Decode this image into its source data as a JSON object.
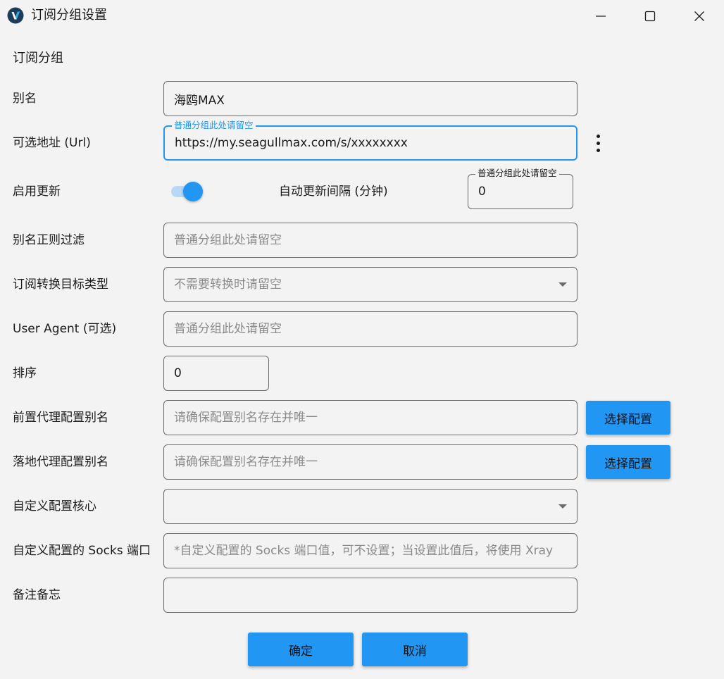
{
  "window": {
    "title": "订阅分组设置"
  },
  "section_title": "订阅分组",
  "form": {
    "alias": {
      "label": "别名",
      "value": "海鸥MAX"
    },
    "url": {
      "label": "可选地址 (Url)",
      "float_label": "普通分组此处请留空",
      "value": "https://my.seagullmax.com/s/xxxxxxxx"
    },
    "enable_update": {
      "label": "启用更新",
      "enabled": true
    },
    "auto_update_interval": {
      "label": "自动更新间隔 (分钟)",
      "float_label": "普通分组此处请留空",
      "value": "0"
    },
    "alias_regex": {
      "label": "别名正则过滤",
      "placeholder": "普通分组此处请留空"
    },
    "convert_target": {
      "label": "订阅转换目标类型",
      "placeholder": "不需要转换时请留空"
    },
    "user_agent": {
      "label": "User Agent (可选)",
      "placeholder": "普通分组此处请留空"
    },
    "sort": {
      "label": "排序",
      "value": "0"
    },
    "prev_proxy": {
      "label": "前置代理配置别名",
      "placeholder": "请确保配置别名存在并唯一",
      "button": "选择配置"
    },
    "next_proxy": {
      "label": "落地代理配置别名",
      "placeholder": "请确保配置别名存在并唯一",
      "button": "选择配置"
    },
    "custom_core": {
      "label": "自定义配置核心",
      "value": ""
    },
    "custom_socks_port": {
      "label": "自定义配置的 Socks 端口",
      "placeholder": "*自定义配置的 Socks 端口值，可不设置；当设置此值后，将使用 Xray"
    },
    "remarks": {
      "label": "备注备忘",
      "value": ""
    }
  },
  "buttons": {
    "ok": "确定",
    "cancel": "取消"
  },
  "colors": {
    "accent": "#2196f3",
    "background": "#f3f3f3",
    "border": "#6b6b6b"
  }
}
